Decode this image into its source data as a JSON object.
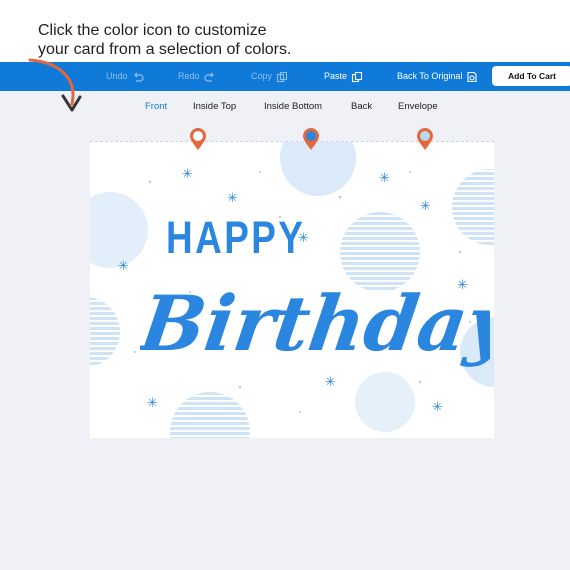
{
  "instruction": {
    "text": "Click the color icon to customize\nyour card from a selection of colors."
  },
  "toolbar": {
    "undo_label": "Undo",
    "redo_label": "Redo",
    "copy_label": "Copy",
    "paste_label": "Paste",
    "back_to_original_label": "Back To Original",
    "add_to_cart_label": "Add To Cart"
  },
  "tabs": [
    {
      "label": "Front",
      "active": true
    },
    {
      "label": "Inside Top",
      "active": false
    },
    {
      "label": "Inside Bottom",
      "active": false
    },
    {
      "label": "Back",
      "active": false
    },
    {
      "label": "Envelope",
      "active": false
    }
  ],
  "card": {
    "line1": "HAPPY",
    "line2": "Birthday"
  },
  "color_pins": [
    {
      "name": "color-pin-white",
      "fill": "#ffffff"
    },
    {
      "name": "color-pin-blue",
      "fill": "#2a86df"
    },
    {
      "name": "color-pin-lightblue",
      "fill": "#b8d9f4"
    }
  ],
  "colors": {
    "toolbar": "#0f7ad8",
    "accent": "#2a86df",
    "pin_outline": "#e3683c",
    "arrow": "#e3683c"
  }
}
